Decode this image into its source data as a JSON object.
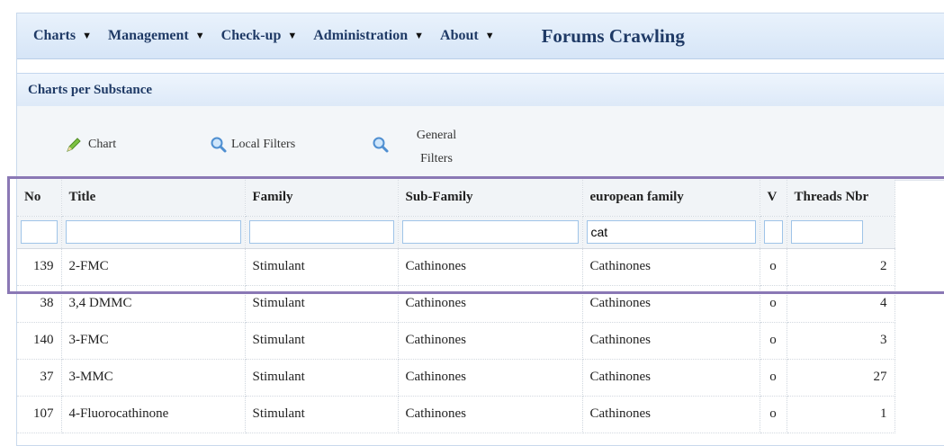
{
  "menu": {
    "items": [
      {
        "label": "Charts"
      },
      {
        "label": "Management"
      },
      {
        "label": "Check-up"
      },
      {
        "label": "Administration"
      },
      {
        "label": "About"
      }
    ],
    "caret": "▼",
    "brand": "Forums Crawling"
  },
  "panel": {
    "title": "Charts per Substance"
  },
  "toolbar": {
    "chart_label": "Chart",
    "local_filters_label": "Local Filters",
    "general_filters_label_1": "General",
    "general_filters_label_2": "Filters"
  },
  "table": {
    "columns": [
      "No",
      "Title",
      "Family",
      "Sub-Family",
      "european family",
      "V",
      "Threads Nbr"
    ],
    "filters": [
      "",
      "",
      "",
      "",
      "cat",
      "",
      ""
    ],
    "rows": [
      {
        "no": "139",
        "title": "2-FMC",
        "family": "Stimulant",
        "subfamily": "Cathinones",
        "european": "Cathinones",
        "v": "o",
        "threads": "2"
      },
      {
        "no": "38",
        "title": "3,4 DMMC",
        "family": "Stimulant",
        "subfamily": "Cathinones",
        "european": "Cathinones",
        "v": "o",
        "threads": "4"
      },
      {
        "no": "140",
        "title": "3-FMC",
        "family": "Stimulant",
        "subfamily": "Cathinones",
        "european": "Cathinones",
        "v": "o",
        "threads": "3"
      },
      {
        "no": "37",
        "title": "3-MMC",
        "family": "Stimulant",
        "subfamily": "Cathinones",
        "european": "Cathinones",
        "v": "o",
        "threads": "27"
      },
      {
        "no": "107",
        "title": "4-Fluorocathinone",
        "family": "Stimulant",
        "subfamily": "Cathinones",
        "european": "Cathinones",
        "v": "o",
        "threads": "1"
      }
    ]
  },
  "colors": {
    "accent": "#1f3a66",
    "highlight": "#8a78b5",
    "filter_border": "#9fc4e8"
  }
}
